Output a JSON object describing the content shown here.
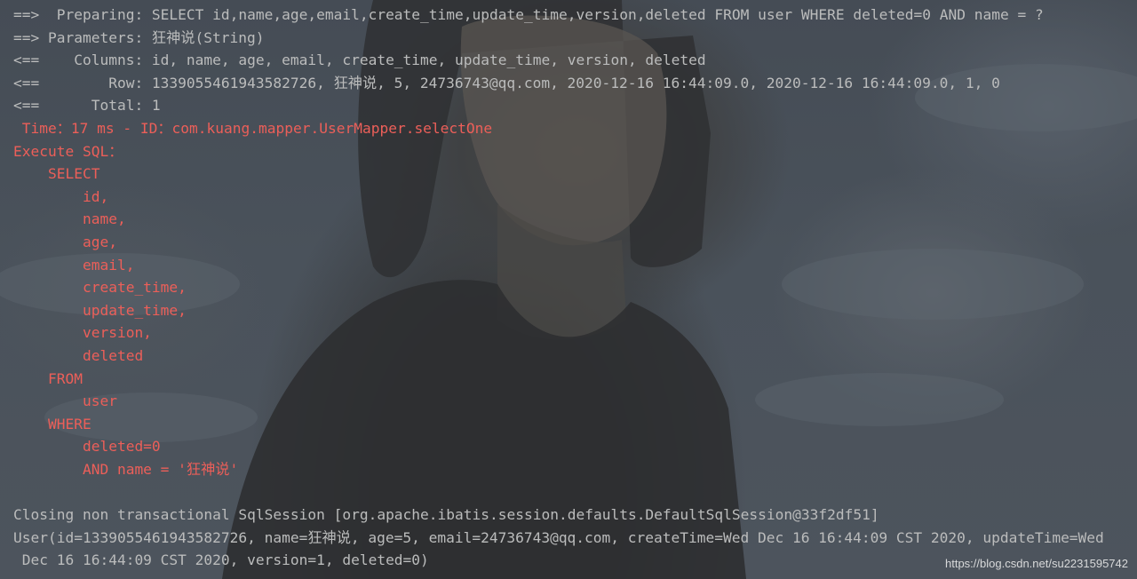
{
  "console": {
    "lines": [
      {
        "text": "==>  Preparing: SELECT id,name,age,email,create_time,update_time,version,deleted FROM user WHERE deleted=0 AND name = ?",
        "color": "#bbbcbc"
      },
      {
        "text": "==> Parameters: 狂神说(String)",
        "color": "#bbbcbc"
      },
      {
        "text": "<==    Columns: id, name, age, email, create_time, update_time, version, deleted",
        "color": "#bbbcbc"
      },
      {
        "text": "<==        Row: 1339055461943582726, 狂神说, 5, 24736743@qq.com, 2020-12-16 16:44:09.0, 2020-12-16 16:44:09.0, 1, 0",
        "color": "#bbbcbc"
      },
      {
        "text": "<==      Total: 1",
        "color": "#bbbcbc"
      },
      {
        "text": " Time：17 ms - ID：com.kuang.mapper.UserMapper.selectOne",
        "color": "#ec5f59"
      },
      {
        "text": "Execute SQL：",
        "color": "#ec5f59"
      },
      {
        "text": "    SELECT",
        "color": "#ec5f59"
      },
      {
        "text": "        id,",
        "color": "#ec5f59"
      },
      {
        "text": "        name,",
        "color": "#ec5f59"
      },
      {
        "text": "        age,",
        "color": "#ec5f59"
      },
      {
        "text": "        email,",
        "color": "#ec5f59"
      },
      {
        "text": "        create_time,",
        "color": "#ec5f59"
      },
      {
        "text": "        update_time,",
        "color": "#ec5f59"
      },
      {
        "text": "        version,",
        "color": "#ec5f59"
      },
      {
        "text": "        deleted",
        "color": "#ec5f59"
      },
      {
        "text": "    FROM",
        "color": "#ec5f59"
      },
      {
        "text": "        user",
        "color": "#ec5f59"
      },
      {
        "text": "    WHERE",
        "color": "#ec5f59"
      },
      {
        "text": "        deleted=0",
        "color": "#ec5f59"
      },
      {
        "text": "        AND name = '狂神说'",
        "color": "#ec5f59"
      },
      {
        "text": "",
        "color": "#bbbcbc"
      },
      {
        "text": "Closing non transactional SqlSession [org.apache.ibatis.session.defaults.DefaultSqlSession@33f2df51]",
        "color": "#bbbcbc"
      },
      {
        "text": "User(id=1339055461943582726, name=狂神说, age=5, email=24736743@qq.com, createTime=Wed Dec 16 16:44:09 CST 2020, updateTime=Wed",
        "color": "#bbbcbc"
      },
      {
        "text": " Dec 16 16:44:09 CST 2020, version=1, deleted=0)",
        "color": "#bbbcbc"
      }
    ]
  },
  "watermark": "https://blog.csdn.net/su2231595742",
  "colors": {
    "log_gray": "#bbbcbc",
    "sql_red": "#ec5f59"
  }
}
